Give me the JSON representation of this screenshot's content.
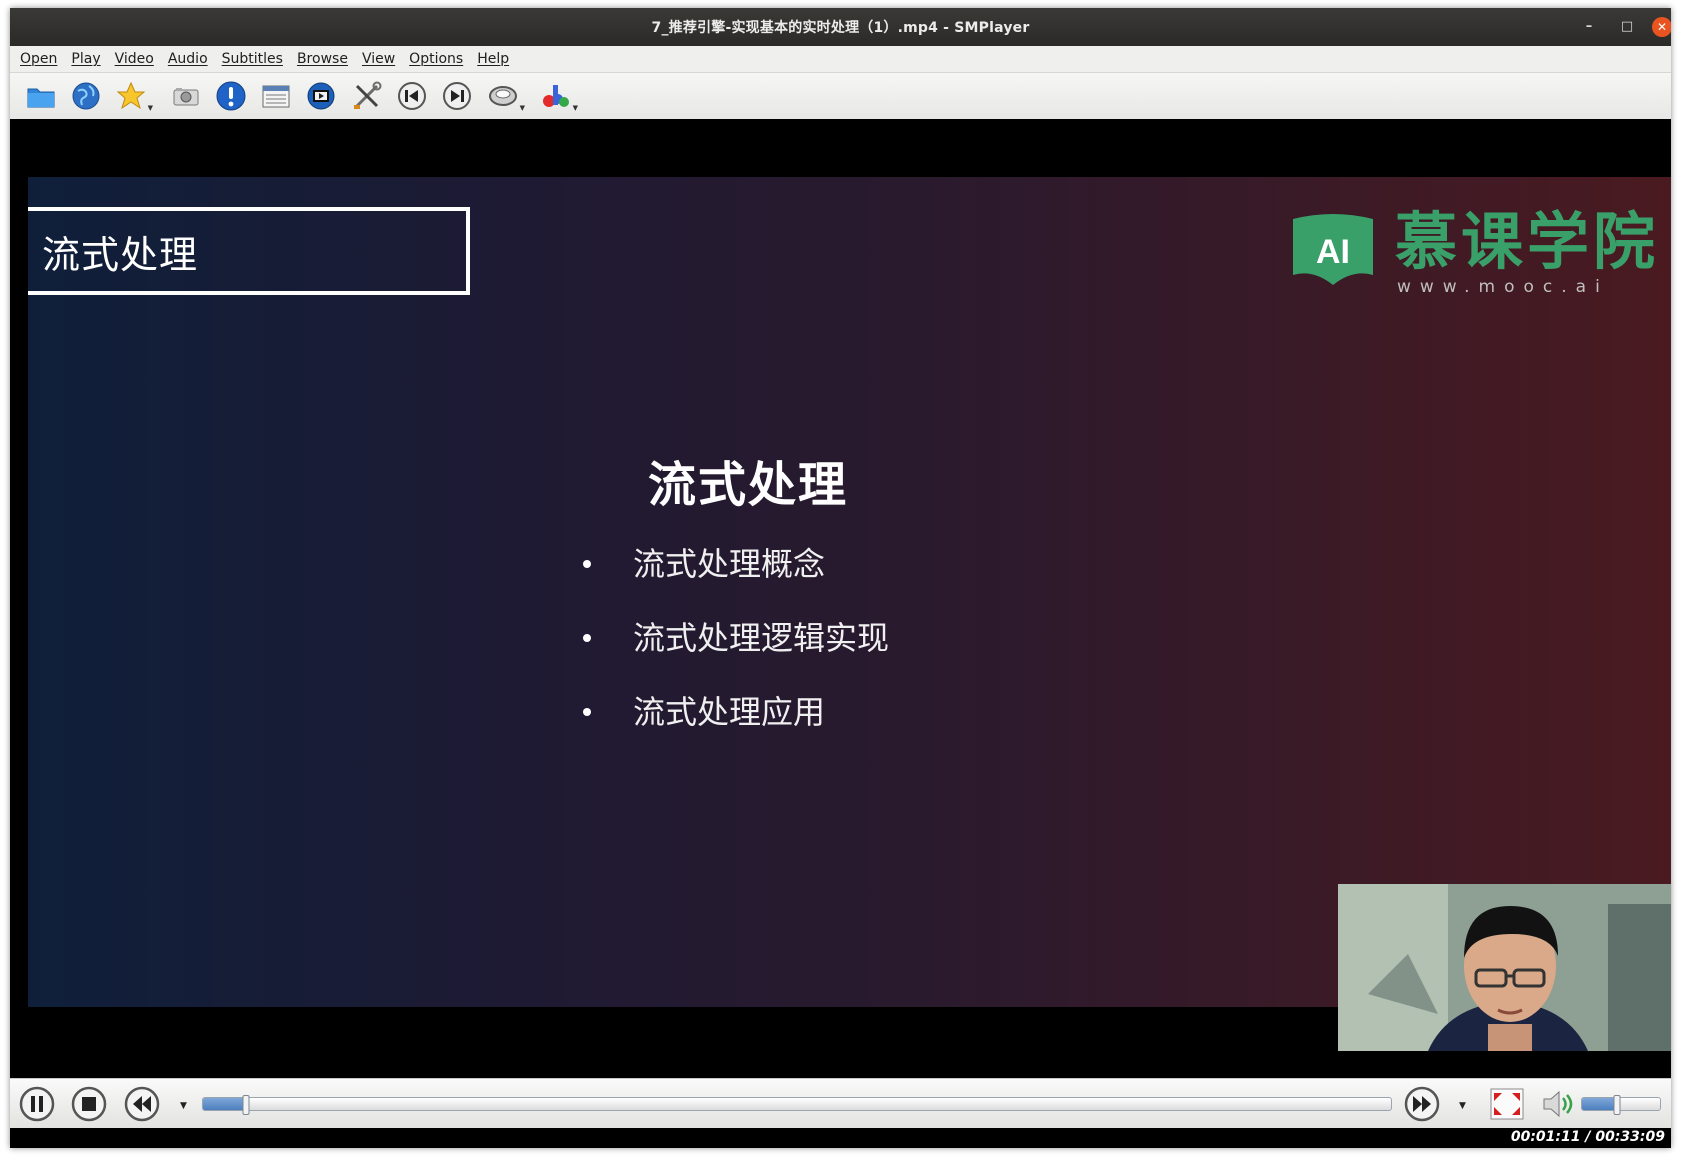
{
  "window": {
    "title": "7_推荐引擎-实现基本的实时处理（1）.mp4 - SMPlayer",
    "controls": {
      "minimize": "–",
      "maximize": "□",
      "close": "✕"
    }
  },
  "menu": [
    "Open",
    "Play",
    "Video",
    "Audio",
    "Subtitles",
    "Browse",
    "View",
    "Options",
    "Help"
  ],
  "toolbar": [
    {
      "icon": "open-folder-icon"
    },
    {
      "icon": "globe-url-icon"
    },
    {
      "icon": "favorites-star-icon",
      "dropdown": true
    },
    {
      "icon": "screenshot-camera-icon"
    },
    {
      "icon": "info-exclamation-icon"
    },
    {
      "icon": "playlist-icon"
    },
    {
      "icon": "video-equalizer-icon"
    },
    {
      "icon": "preferences-tools-icon"
    },
    {
      "icon": "previous-icon"
    },
    {
      "icon": "next-icon"
    },
    {
      "icon": "audio-track-icon",
      "dropdown": true
    },
    {
      "icon": "subtitles-abc-icon",
      "dropdown": true
    }
  ],
  "slide": {
    "header": "流式处理",
    "logo_badge": "AI",
    "logo_name": "慕课学院",
    "logo_url": "www.mooc.ai",
    "title": "流式处理",
    "bullets": [
      "流式处理概念",
      "流式处理逻辑实现",
      "流式处理应用"
    ]
  },
  "controls": {
    "seek_progress": 0.036,
    "volume_level": 0.45,
    "time_display": "00:01:11 / 00:33:09"
  },
  "colors": {
    "logo_green": "#3aa06a",
    "titlebar": "#2b2a28",
    "close_button": "#e95420",
    "progress_blue": "#4c7fbf"
  }
}
